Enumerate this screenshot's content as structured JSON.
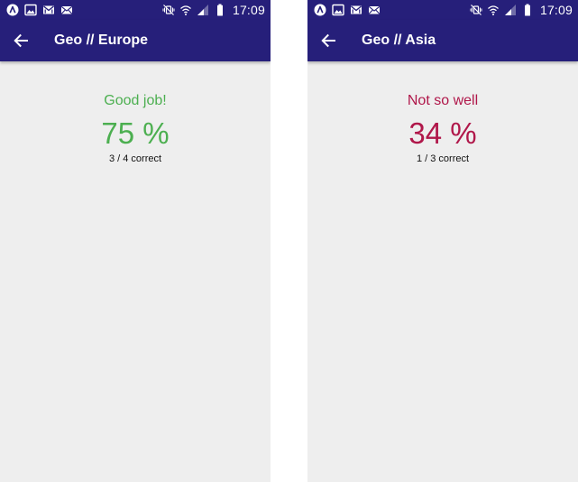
{
  "colors": {
    "app_bar": "#261f7a",
    "background": "#eeeeee",
    "good": "#4caf50",
    "bad": "#b0174a"
  },
  "status_bar": {
    "time": "17:09",
    "left_icons": [
      "launcher-icon",
      "gallery-icon",
      "gmail-icon",
      "email-icon"
    ],
    "right_icons": [
      "vibrate-mute-icon",
      "wifi-icon",
      "cellular-signal-icon",
      "battery-icon"
    ]
  },
  "screens": [
    {
      "title": "Geo // Europe",
      "verdict": "Good job!",
      "percent": "75 %",
      "count": "3 / 4 correct",
      "status": "good"
    },
    {
      "title": "Geo // Asia",
      "verdict": "Not so well",
      "percent": "34 %",
      "count": "1 / 3 correct",
      "status": "bad"
    }
  ]
}
